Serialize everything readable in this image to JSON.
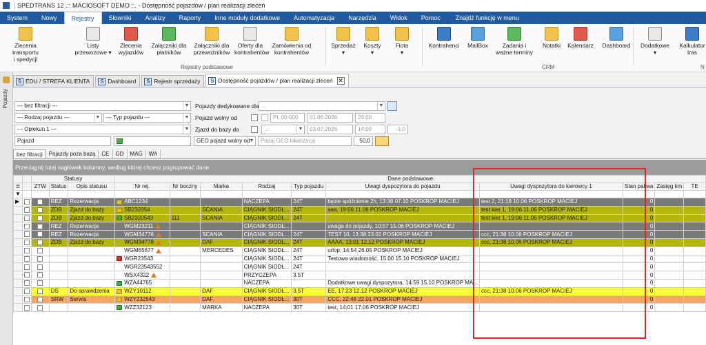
{
  "window": {
    "title": "SPEDTRANS 12 .:: MACIOSOFT DEMO ::. - Dostępność pojazdów / plan realizacji zleceń"
  },
  "menu": {
    "items": [
      "System",
      "Nowy",
      "Rejestry",
      "Słowniki",
      "Analizy",
      "Raporty",
      "Inne moduły dodatkowe",
      "Automatyzacja",
      "Narzędzia",
      "Widok",
      "Pomoc"
    ],
    "active": "Rejestry",
    "search": "Znajdź funkcję w menu"
  },
  "ribbon": {
    "buttons": [
      {
        "label": "Zlecenia transportu\ni spedycji",
        "icon": "orders-icon"
      },
      {
        "label": "Listy\nprzewozowe ▾",
        "icon": "waybills-icon"
      },
      {
        "label": "Zlecenia\nwyjazdów",
        "icon": "departures-icon"
      },
      {
        "label": "Załączniki dla\npłatników",
        "icon": "attachments-payers-icon"
      },
      {
        "label": "Załączniki dla\nprzewoźników",
        "icon": "attachments-carriers-icon"
      },
      {
        "label": "Oferty dla\nkontrahentów",
        "icon": "offers-icon"
      },
      {
        "label": "Zamówienia od\nkontrahentów",
        "icon": "customer-orders-icon"
      },
      {
        "label": "Sprzedaż\n▾",
        "icon": "sales-icon"
      },
      {
        "label": "Koszty\n▾",
        "icon": "costs-icon"
      },
      {
        "label": "Flota\n▾",
        "icon": "fleet-icon"
      },
      {
        "label": "Kontrahenci",
        "icon": "contractors-icon"
      },
      {
        "label": "MailBox",
        "icon": "mailbox-icon"
      },
      {
        "label": "Zadania i\nważne terminy",
        "icon": "tasks-icon"
      },
      {
        "label": "Notatki",
        "icon": "notes-icon"
      },
      {
        "label": "Kalendarz",
        "icon": "calendar-icon"
      },
      {
        "label": "Dashboard",
        "icon": "dashboard-icon"
      },
      {
        "label": "Dodatkowe\n▾",
        "icon": "extra-icon"
      },
      {
        "label": "Kalkulator\ntras",
        "icon": "route-calculator-icon"
      }
    ],
    "group_registers": "Rejestry podstawowe",
    "group_crm": "CRM",
    "group_more": "N"
  },
  "sidebar": {
    "label": "Pojazdy"
  },
  "doc_tabs": [
    "EDU / STREFA KLIENTA",
    "Dashboard",
    "Rejestr sprzedaży",
    "Dostępność pojazdów / plan realizacji zleceń"
  ],
  "filters": {
    "filter_mode": "--- bez filtracji ---",
    "vehicle_type_kind": "--- Rodzaj pojazdu ---",
    "vehicle_type": "--- Typ pojazdu ---",
    "guardian": "--- Opiekun 1 ---",
    "vehicle": "Pojazd",
    "dedicated_label": "Pojazdy dedykowane dla",
    "dedicated_value": "...",
    "free_from_label": "Pojazd wolny od",
    "free_from_place": "PL 00-000",
    "free_from_date": "01.06.2026",
    "free_from_time": "23:00",
    "return_label": "Zjazd do bazy do",
    "return_place": "...",
    "return_date": "03.07.2026",
    "return_time": "14:00",
    "return_offset": "-1,0",
    "geo_label": "GEO pojazd wolny od",
    "geo_placeholder": "Podaj GEO lokalizację",
    "geo_radius": "50,0"
  },
  "subtabs": [
    "bez filtracji",
    "Pojazdy poza bazą",
    "CE",
    "GD",
    "MAG",
    "WA"
  ],
  "group_hint": "Przeciągnij tutaj nagłówek kolumny, według której chcesz pogrupować dane",
  "grid": {
    "band_statusy": "Statusy",
    "band_dane": "Dane podstawowe",
    "columns": [
      "ZTW",
      "Status",
      "Opis statusu",
      "Nr rej.",
      "Nr boczny",
      "Marka",
      "Rodzaj",
      "Typ pojazdu",
      "Uwagi dyspozytora do pojazdu",
      "Uwagi dyspozytora do kierowcy 1",
      "Stan paliwa",
      "Zasięg km",
      "TE"
    ],
    "rows": [
      {
        "status": "REZ",
        "desc": "Rezerwacja",
        "reg": "ABC1234",
        "side": "",
        "make": "",
        "kind": "NACZEPA",
        "vtype": "24T",
        "note_vehicle": "bęzie spóźnienie 2h, 13:36 07.10 POSKROP MACIEJ",
        "note_driver": "test 2, 21:18 10.06 POSKROP MACIEJ",
        "fuel": "0",
        "bg": "#7a7a7a",
        "fg": "#ffffff",
        "icon": "yellow",
        "warn": false,
        "current": true
      },
      {
        "status": "ZDB",
        "desc": "Zjazd do bazy",
        "reg": "SB232054",
        "side": "",
        "make": "SCANIA",
        "kind": "CIĄGNIK SIODŁ...",
        "vtype": "24T",
        "note_vehicle": "aaa, 19:06 11.06 POSKROP MACIEJ",
        "note_driver": "test kier 1, 19:06 11.06 POSKROP MACIEJ",
        "fuel": "0",
        "bg": "#b5b50e",
        "fg": "#1a1a1a",
        "icon": "yellow",
        "warn": false,
        "current": false
      },
      {
        "status": "ZDB",
        "desc": "Zjazd do bazy",
        "reg": "SB2320543",
        "side": "111",
        "make": "SCANIA",
        "kind": "CIĄGNIK SIODŁ...",
        "vtype": "24T",
        "note_vehicle": "",
        "note_driver": "test kier 1, 19:06 11.06 POSKROP MACIEJ",
        "fuel": "0",
        "bg": "#b5b50e",
        "fg": "#1a1a1a",
        "icon": "green",
        "warn": false,
        "current": false
      },
      {
        "status": "REZ",
        "desc": "Rezerwacja",
        "reg": "WGM23211",
        "side": "",
        "make": "",
        "kind": "CIĄGNIK SIODŁ...",
        "vtype": "",
        "note_vehicle": "uwaga do pojazdy, 10:57 15.06 POSKROP MACIEJ",
        "note_driver": "",
        "fuel": "0",
        "bg": "#7a7a7a",
        "fg": "#ffffff",
        "icon": "",
        "warn": true,
        "current": false
      },
      {
        "status": "REZ",
        "desc": "Rezerwacja",
        "reg": "WGM34776",
        "side": "",
        "make": "SCANIA",
        "kind": "CIĄGNIK SIODŁ...",
        "vtype": "24T",
        "note_vehicle": "TEST 10, 13:38 23.02 POSKROP MACIEJ",
        "note_driver": "ccc, 21:38 10.06 POSKROP MACIEJ",
        "fuel": "0",
        "bg": "#7a7a7a",
        "fg": "#ffffff",
        "icon": "",
        "warn": true,
        "current": false
      },
      {
        "status": "ZDB",
        "desc": "Zjazd do bazy",
        "reg": "WGM34778",
        "side": "",
        "make": "DAF",
        "kind": "CIĄGNIK SIODŁ...",
        "vtype": "24T",
        "note_vehicle": "AAAA, 13:01 12.12 POSKROP MACIEJ",
        "note_driver": "ccc, 21:38 10.06 POSKROP MACIEJ",
        "fuel": "0",
        "bg": "#b5b50e",
        "fg": "#1a1a1a",
        "icon": "",
        "warn": true,
        "current": false
      },
      {
        "status": "",
        "desc": "",
        "reg": "WGM65677",
        "side": "",
        "make": "MERCEDES",
        "kind": "CIĄGNIK SIODŁ...",
        "vtype": "24T",
        "note_vehicle": "urlop, 14:54 26.05 POSKROP MACIEJ",
        "note_driver": "",
        "fuel": "0",
        "bg": "#ffffff",
        "fg": "#1a1a1a",
        "icon": "",
        "warn": true,
        "current": false
      },
      {
        "status": "",
        "desc": "",
        "reg": "WGR23543",
        "side": "",
        "make": "",
        "kind": "CIĄGNIK SIODŁ...",
        "vtype": "24T",
        "note_vehicle": "Testowa wiadomość, 15:00 15.10 POSKROP MACIEJ",
        "note_driver": "",
        "fuel": "0",
        "bg": "#ffffff",
        "fg": "#1a1a1a",
        "icon": "red",
        "warn": false,
        "current": false
      },
      {
        "status": "",
        "desc": "",
        "reg": "WGR23543552",
        "side": "",
        "make": "",
        "kind": "CIĄGNIK SIODŁ...",
        "vtype": "24T",
        "note_vehicle": "",
        "note_driver": "",
        "fuel": "0",
        "bg": "#ffffff",
        "fg": "#1a1a1a",
        "icon": "",
        "warn": false,
        "current": false
      },
      {
        "status": "",
        "desc": "",
        "reg": "WSX4322",
        "side": "",
        "make": "",
        "kind": "PRZYCZEPA",
        "vtype": "3.5T",
        "note_vehicle": "",
        "note_driver": "",
        "fuel": "0",
        "bg": "#ffffff",
        "fg": "#1a1a1a",
        "icon": "",
        "warn": true,
        "current": false
      },
      {
        "status": "",
        "desc": "",
        "reg": "WZA44765",
        "side": "",
        "make": "",
        "kind": "NACZEPA",
        "vtype": "",
        "note_vehicle": "Dodatkowe uwagi dyspozytora, 14:59 15.10 POSKROP MA...",
        "note_driver": "",
        "fuel": "0",
        "bg": "#ffffff",
        "fg": "#1a1a1a",
        "icon": "green",
        "warn": false,
        "current": false
      },
      {
        "status": "DS",
        "desc": "Do sprawdzenia",
        "reg": "WZY10112",
        "side": "",
        "make": "DAF",
        "kind": "CIĄGNIK SIODŁ...",
        "vtype": "3.5T",
        "note_vehicle": "EE, 17:23 12.12 POSKROP MACIEJ",
        "note_driver": "ccc, 21:38 10.06 POSKROP MACIEJ",
        "fuel": "0",
        "bg": "#ffff33",
        "fg": "#1a1a1a",
        "icon": "yellow",
        "warn": false,
        "current": false
      },
      {
        "status": "SRW",
        "desc": "Serwis",
        "reg": "WZY232543",
        "side": "",
        "make": "DAF",
        "kind": "CIĄGNIK SIODŁ...",
        "vtype": "30T",
        "note_vehicle": "CCC, 22:48 22.01 POSKROP MACIEJ",
        "note_driver": "",
        "fuel": "0",
        "bg": "#f5a662",
        "fg": "#1a1a1a",
        "icon": "yellow",
        "warn": false,
        "current": false
      },
      {
        "status": "",
        "desc": "",
        "reg": "WZZ32123",
        "side": "",
        "make": "MARKA",
        "kind": "NACZEPA",
        "vtype": "30T",
        "note_vehicle": "test, 14:01 17.06 POSKROP MACIEJ",
        "note_driver": "",
        "fuel": "0",
        "bg": "#ffffff",
        "fg": "#1a1a1a",
        "icon": "green",
        "warn": false,
        "current": false
      }
    ]
  }
}
